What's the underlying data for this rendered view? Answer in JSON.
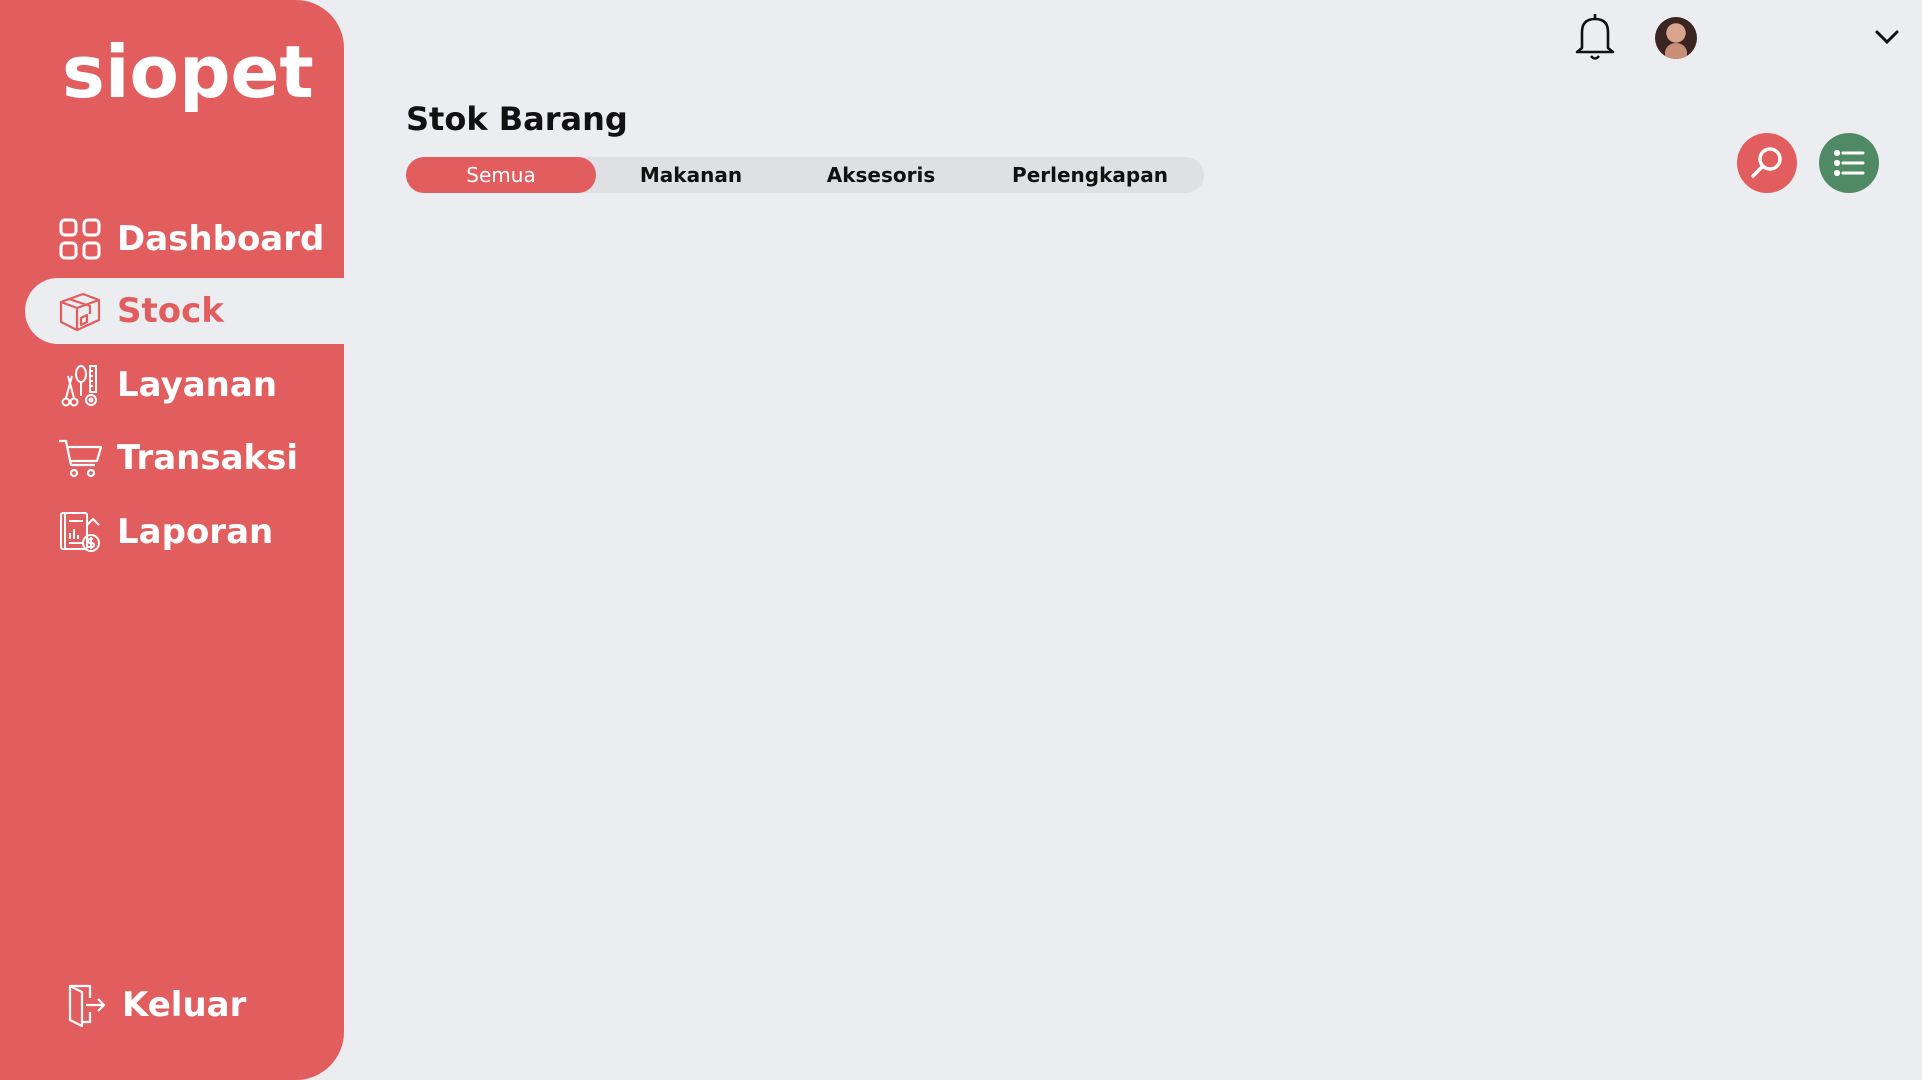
{
  "app": {
    "logo": "siopet"
  },
  "colors": {
    "accent": "#e25d5e",
    "background": "#ecedf1",
    "list_button": "#4f8a64"
  },
  "sidebar": {
    "items": [
      {
        "label": "Dashboard",
        "icon": "grid-icon",
        "active": false
      },
      {
        "label": "Stock",
        "icon": "box-icon",
        "active": true
      },
      {
        "label": "Layanan",
        "icon": "grooming-tools-icon",
        "active": false
      },
      {
        "label": "Transaksi",
        "icon": "cart-icon",
        "active": false
      },
      {
        "label": "Laporan",
        "icon": "report-icon",
        "active": false
      }
    ],
    "logout": {
      "label": "Keluar",
      "icon": "exit-door-icon"
    }
  },
  "header": {
    "icons": [
      "bell-icon",
      "avatar",
      "chevron-down-icon"
    ]
  },
  "main": {
    "title": "Stok Barang",
    "tabs": [
      {
        "label": "Semua",
        "active": true
      },
      {
        "label": "Makanan",
        "active": false
      },
      {
        "label": "Aksesoris",
        "active": false
      },
      {
        "label": "Perlengkapan",
        "active": false
      }
    ],
    "actions": [
      "search-icon",
      "list-icon"
    ]
  }
}
